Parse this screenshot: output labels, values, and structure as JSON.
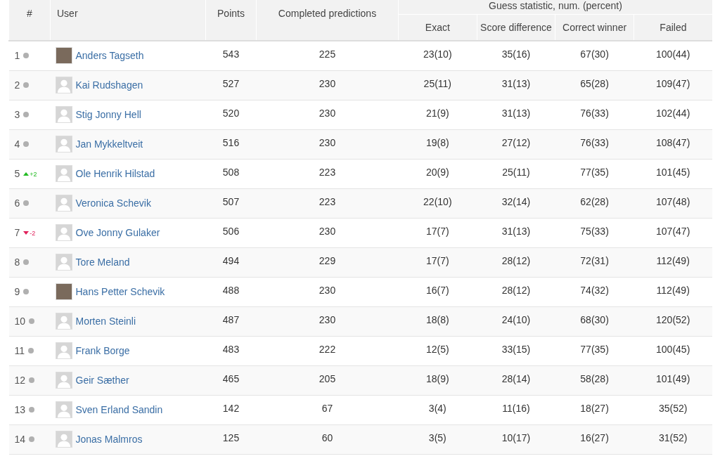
{
  "table": {
    "columns": {
      "rank": "#",
      "user": "User",
      "points": "Points",
      "completed": "Completed predictions",
      "group": "Guess statistic, num. (percent)",
      "exact": "Exact",
      "score_difference": "Score difference",
      "correct_winner": "Correct winner",
      "failed": "Failed"
    },
    "rows": [
      {
        "rank": "1",
        "trend": {
          "kind": "same"
        },
        "user": "Anders Tagseth",
        "has_photo": true,
        "points": "543",
        "completed": "225",
        "exact": "23(10)",
        "score_difference": "35(16)",
        "correct_winner": "67(30)",
        "failed": "100(44)"
      },
      {
        "rank": "2",
        "trend": {
          "kind": "same"
        },
        "user": "Kai Rudshagen",
        "has_photo": false,
        "points": "527",
        "completed": "230",
        "exact": "25(11)",
        "score_difference": "31(13)",
        "correct_winner": "65(28)",
        "failed": "109(47)"
      },
      {
        "rank": "3",
        "trend": {
          "kind": "same"
        },
        "user": "Stig Jonny Hell",
        "has_photo": false,
        "points": "520",
        "completed": "230",
        "exact": "21(9)",
        "score_difference": "31(13)",
        "correct_winner": "76(33)",
        "failed": "102(44)"
      },
      {
        "rank": "4",
        "trend": {
          "kind": "same"
        },
        "user": "Jan Mykkeltveit",
        "has_photo": false,
        "points": "516",
        "completed": "230",
        "exact": "19(8)",
        "score_difference": "27(12)",
        "correct_winner": "76(33)",
        "failed": "108(47)"
      },
      {
        "rank": "5",
        "trend": {
          "kind": "up",
          "change": "+2"
        },
        "user": "Ole Henrik Hilstad",
        "has_photo": false,
        "points": "508",
        "completed": "223",
        "exact": "20(9)",
        "score_difference": "25(11)",
        "correct_winner": "77(35)",
        "failed": "101(45)"
      },
      {
        "rank": "6",
        "trend": {
          "kind": "same"
        },
        "user": "Veronica Schevik",
        "has_photo": false,
        "points": "507",
        "completed": "223",
        "exact": "22(10)",
        "score_difference": "32(14)",
        "correct_winner": "62(28)",
        "failed": "107(48)"
      },
      {
        "rank": "7",
        "trend": {
          "kind": "down",
          "change": "-2"
        },
        "user": "Ove Jonny Gulaker",
        "has_photo": false,
        "points": "506",
        "completed": "230",
        "exact": "17(7)",
        "score_difference": "31(13)",
        "correct_winner": "75(33)",
        "failed": "107(47)"
      },
      {
        "rank": "8",
        "trend": {
          "kind": "same"
        },
        "user": "Tore Meland",
        "has_photo": false,
        "points": "494",
        "completed": "229",
        "exact": "17(7)",
        "score_difference": "28(12)",
        "correct_winner": "72(31)",
        "failed": "112(49)"
      },
      {
        "rank": "9",
        "trend": {
          "kind": "same"
        },
        "user": "Hans Petter Schevik",
        "has_photo": true,
        "points": "488",
        "completed": "230",
        "exact": "16(7)",
        "score_difference": "28(12)",
        "correct_winner": "74(32)",
        "failed": "112(49)"
      },
      {
        "rank": "10",
        "trend": {
          "kind": "same"
        },
        "user": "Morten Steinli",
        "has_photo": false,
        "points": "487",
        "completed": "230",
        "exact": "18(8)",
        "score_difference": "24(10)",
        "correct_winner": "68(30)",
        "failed": "120(52)"
      },
      {
        "rank": "11",
        "trend": {
          "kind": "same"
        },
        "user": "Frank Borge",
        "has_photo": false,
        "points": "483",
        "completed": "222",
        "exact": "12(5)",
        "score_difference": "33(15)",
        "correct_winner": "77(35)",
        "failed": "100(45)"
      },
      {
        "rank": "12",
        "trend": {
          "kind": "same"
        },
        "user": "Geir Sæther",
        "has_photo": false,
        "points": "465",
        "completed": "205",
        "exact": "18(9)",
        "score_difference": "28(14)",
        "correct_winner": "58(28)",
        "failed": "101(49)"
      },
      {
        "rank": "13",
        "trend": {
          "kind": "same"
        },
        "user": "Sven Erland Sandin",
        "has_photo": false,
        "points": "142",
        "completed": "67",
        "exact": "3(4)",
        "score_difference": "11(16)",
        "correct_winner": "18(27)",
        "failed": "35(52)"
      },
      {
        "rank": "14",
        "trend": {
          "kind": "same"
        },
        "user": "Jonas Malmros",
        "has_photo": false,
        "points": "125",
        "completed": "60",
        "exact": "3(5)",
        "score_difference": "10(17)",
        "correct_winner": "16(27)",
        "failed": "31(52)"
      }
    ]
  }
}
